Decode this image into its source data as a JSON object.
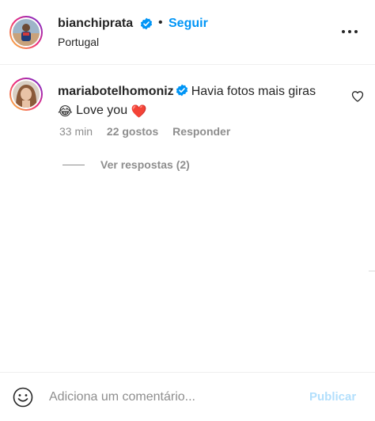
{
  "header": {
    "username": "bianchiprata",
    "separator": "•",
    "follow_label": "Seguir",
    "location": "Portugal",
    "icons": {
      "verified": "verified-badge-icon",
      "more": "more-options-icon"
    }
  },
  "comment": {
    "username": "mariabotelhomoniz",
    "text_line1": "Havia fotos mais giras",
    "text_line2": "Love you",
    "emoji_start": "😂",
    "emoji_end": "❤️",
    "time": "33 min",
    "likes": "22 gostos",
    "reply_label": "Responder",
    "view_replies_label": "Ver respostas (2)",
    "icons": {
      "verified": "verified-badge-icon",
      "like": "heart-outline-icon"
    }
  },
  "footer": {
    "placeholder": "Adiciona um comentário...",
    "post_label": "Publicar",
    "icons": {
      "emoji": "emoji-smiley-icon"
    }
  },
  "colors": {
    "accent": "#0095f6",
    "text": "#262626",
    "secondary_text": "#8e8e8e",
    "post_disabled": "#b2dffc",
    "border": "#efefef"
  }
}
